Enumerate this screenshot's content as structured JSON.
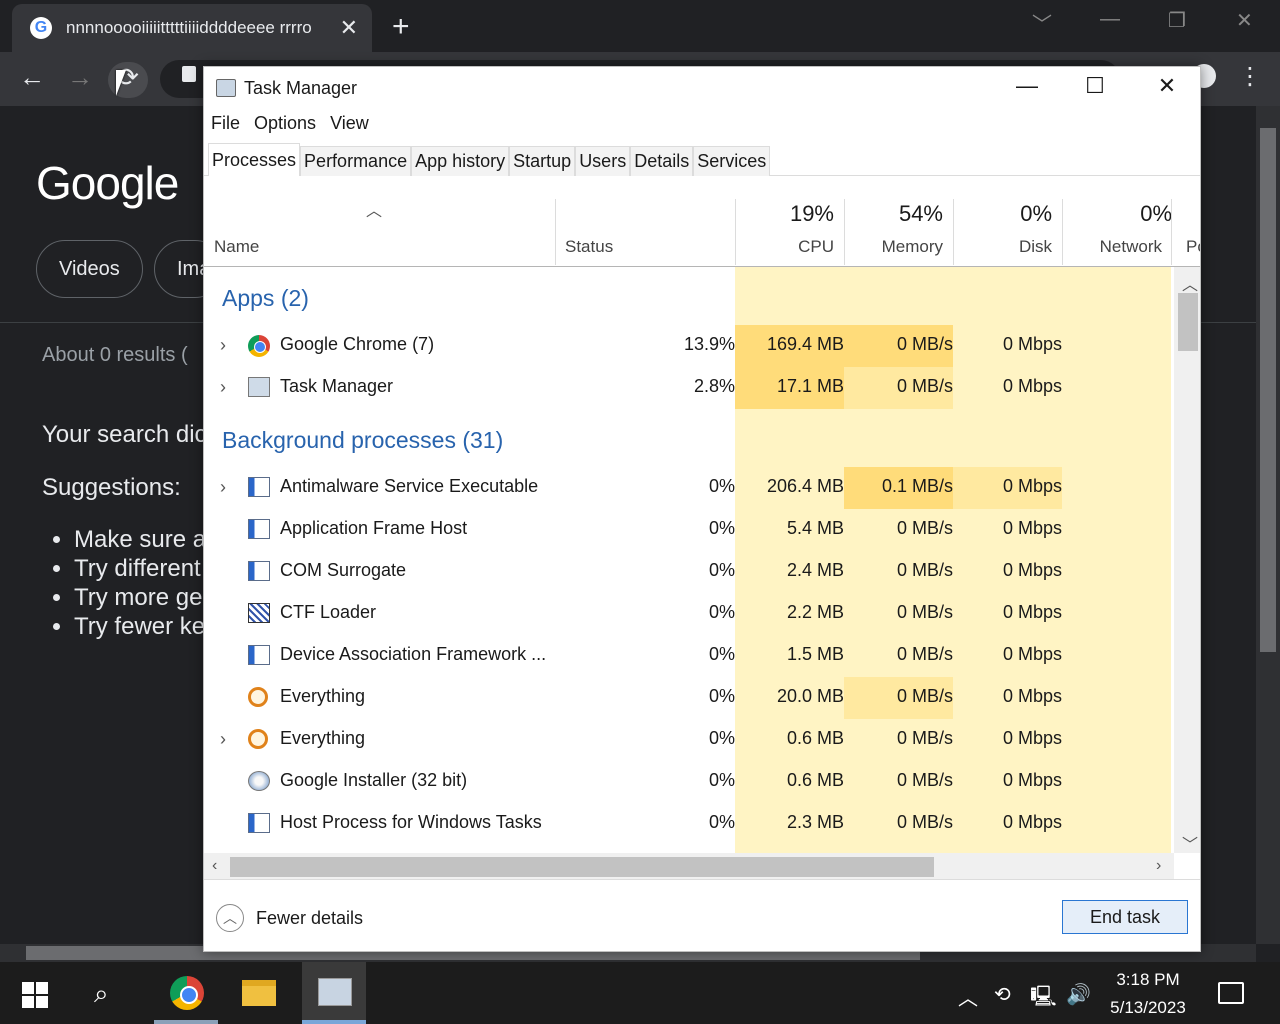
{
  "browser": {
    "tab_title": "nnnnooooiiiiitttttiiiiddddeeee rrrro",
    "tab_close": "✕",
    "new_tab": "+",
    "logo": "Google",
    "chips": [
      "Videos",
      "Ima"
    ],
    "results_count": "About 0 results (",
    "no_match": "Your search dic",
    "suggestions_heading": "Suggestions:",
    "suggestions": [
      "Make sure a",
      "Try different",
      "Try more ger",
      "Try fewer ke"
    ]
  },
  "task_manager": {
    "title": "Task Manager",
    "menu": [
      "File",
      "Options",
      "View"
    ],
    "tabs": [
      "Processes",
      "Performance",
      "App history",
      "Startup",
      "Users",
      "Details",
      "Services"
    ],
    "active_tab": "Processes",
    "columns": {
      "name": "Name",
      "status": "Status",
      "cpu": {
        "pct": "19%",
        "label": "CPU"
      },
      "memory": {
        "pct": "54%",
        "label": "Memory"
      },
      "disk": {
        "pct": "0%",
        "label": "Disk"
      },
      "network": {
        "pct": "0%",
        "label": "Network"
      },
      "power": "Po"
    },
    "groups": {
      "apps": "Apps (2)",
      "background": "Background processes (31)"
    },
    "apps": [
      {
        "name": "Google Chrome (7)",
        "icon": "chrome-icon",
        "expand": true,
        "cpu": "13.9%",
        "memory": "169.4 MB",
        "disk": "0 MB/s",
        "network": "0 Mbps"
      },
      {
        "name": "Task Manager",
        "icon": "task-manager-icon",
        "expand": true,
        "cpu": "2.8%",
        "memory": "17.1 MB",
        "disk": "0 MB/s",
        "network": "0 Mbps"
      }
    ],
    "background": [
      {
        "name": "Antimalware Service Executable",
        "icon": "window-icon",
        "expand": true,
        "cpu": "0%",
        "memory": "206.4 MB",
        "disk": "0.1 MB/s",
        "network": "0 Mbps"
      },
      {
        "name": "Application Frame Host",
        "icon": "window-icon",
        "expand": false,
        "cpu": "0%",
        "memory": "5.4 MB",
        "disk": "0 MB/s",
        "network": "0 Mbps"
      },
      {
        "name": "COM Surrogate",
        "icon": "window-icon",
        "expand": false,
        "cpu": "0%",
        "memory": "2.4 MB",
        "disk": "0 MB/s",
        "network": "0 Mbps"
      },
      {
        "name": "CTF Loader",
        "icon": "ctf-icon",
        "expand": false,
        "cpu": "0%",
        "memory": "2.2 MB",
        "disk": "0 MB/s",
        "network": "0 Mbps"
      },
      {
        "name": "Device Association Framework ...",
        "icon": "window-icon",
        "expand": false,
        "cpu": "0%",
        "memory": "1.5 MB",
        "disk": "0 MB/s",
        "network": "0 Mbps"
      },
      {
        "name": "Everything",
        "icon": "everything-icon",
        "expand": false,
        "cpu": "0%",
        "memory": "20.0 MB",
        "disk": "0 MB/s",
        "network": "0 Mbps"
      },
      {
        "name": "Everything",
        "icon": "everything-icon",
        "expand": true,
        "cpu": "0%",
        "memory": "0.6 MB",
        "disk": "0 MB/s",
        "network": "0 Mbps"
      },
      {
        "name": "Google Installer (32 bit)",
        "icon": "installer-icon",
        "expand": false,
        "cpu": "0%",
        "memory": "0.6 MB",
        "disk": "0 MB/s",
        "network": "0 Mbps"
      },
      {
        "name": "Host Process for Windows Tasks",
        "icon": "window-icon",
        "expand": false,
        "cpu": "0%",
        "memory": "2.3 MB",
        "disk": "0 MB/s",
        "network": "0 Mbps"
      }
    ],
    "fewer_details": "Fewer details",
    "end_task": "End task"
  },
  "taskbar": {
    "time": "3:18 PM",
    "date": "5/13/2023"
  },
  "colors": {
    "heat_light": "#fff4c4",
    "heat_mid": "#ffe9a0",
    "heat_strong": "#ffdc7a",
    "group_title": "#2863ad",
    "taskbar_active": "#7aa6d8",
    "taskbar_open": "#8aa0b8"
  }
}
